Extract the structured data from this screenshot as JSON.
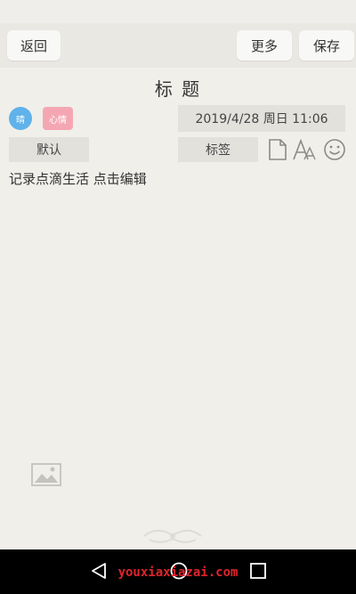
{
  "header": {
    "back_label": "返回",
    "more_label": "更多",
    "save_label": "保存"
  },
  "note": {
    "title": "标 题",
    "datetime": "2019/4/28 周日 11:06",
    "category": "默认",
    "tag_label": "标签",
    "body_placeholder": "记录点滴生活 点击编辑"
  },
  "badges": {
    "blue_text": "晴",
    "pink_text": "心情"
  },
  "watermark": "youxiaxiazai.com",
  "icons": [
    "doc-icon",
    "font-icon",
    "emoji-icon",
    "image-icon",
    "nav-back-icon",
    "nav-home-icon",
    "nav-recent-icon"
  ],
  "colors": {
    "background": "#f0efea",
    "blue_badge": "#5fb2ea",
    "pink_badge": "#f4a7b3",
    "watermark": "#e0242b"
  }
}
